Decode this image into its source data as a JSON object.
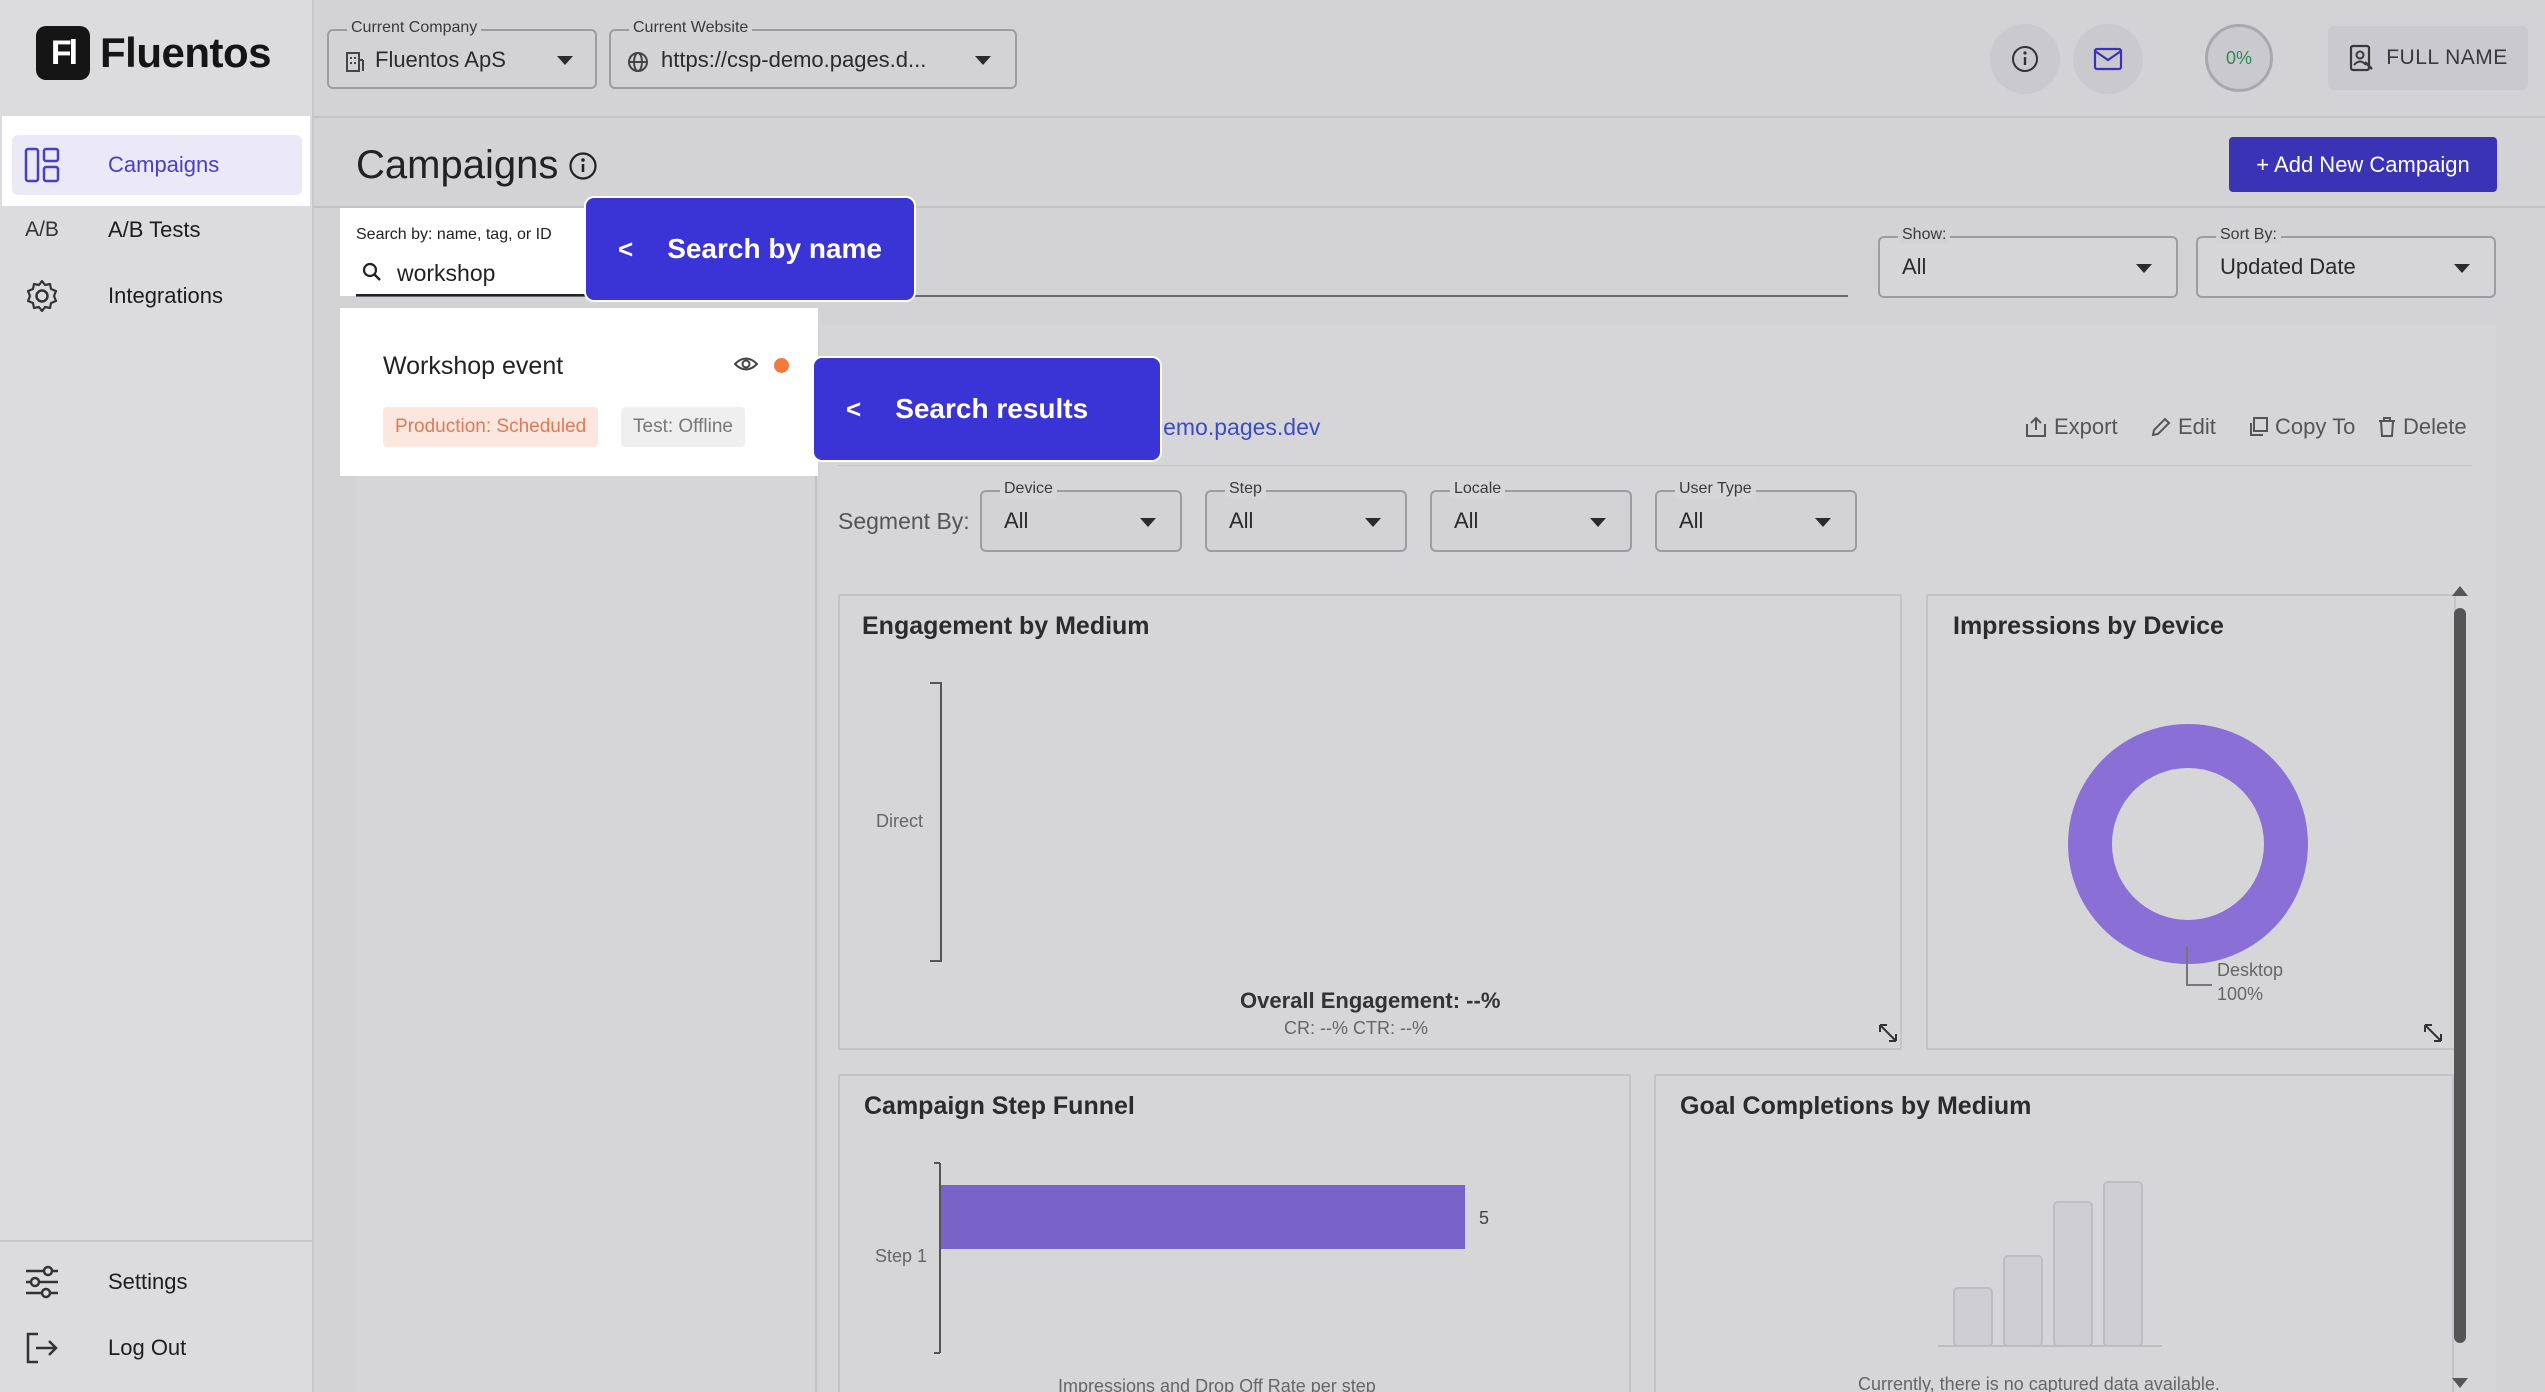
{
  "brand": {
    "logo_mark": "Fl",
    "name": "Fluentos"
  },
  "sidebar": {
    "items": [
      {
        "label": "Campaigns",
        "icon": "layout-icon",
        "active": true
      },
      {
        "label": "A/B Tests",
        "icon_text": "A/B"
      },
      {
        "label": "Integrations",
        "icon": "gear-icon"
      }
    ],
    "bottom": [
      {
        "label": "Settings",
        "icon": "sliders-icon"
      },
      {
        "label": "Log Out",
        "icon": "logout-icon"
      }
    ]
  },
  "topbar": {
    "company": {
      "caption": "Current Company",
      "value": "Fluentos ApS"
    },
    "website": {
      "caption": "Current Website",
      "value": "https://csp-demo.pages.d..."
    },
    "progress": "0%",
    "user": "FULL NAME"
  },
  "header": {
    "title": "Campaigns",
    "add_button": "+ Add New Campaign"
  },
  "search": {
    "caption": "Search by: name, tag, or ID",
    "value": "workshop"
  },
  "popovers": {
    "search": "Search by name",
    "results": "Search results",
    "arrow": "<"
  },
  "filters": {
    "show": {
      "caption": "Show:",
      "value": "All"
    },
    "sort": {
      "caption": "Sort By:",
      "value": "Updated Date"
    }
  },
  "results": [
    {
      "name": "Workshop event",
      "production": "Production: Scheduled",
      "test": "Test: Offline"
    }
  ],
  "detail": {
    "url_fragment": "lemo.pages.dev",
    "actions": {
      "export": "Export",
      "edit": "Edit",
      "copy": "Copy To",
      "delete": "Delete"
    },
    "segment_label": "Segment By:",
    "segments": [
      {
        "caption": "Device",
        "value": "All"
      },
      {
        "caption": "Step",
        "value": "All"
      },
      {
        "caption": "Locale",
        "value": "All"
      },
      {
        "caption": "User Type",
        "value": "All"
      }
    ]
  },
  "charts": {
    "engagement": {
      "title": "Engagement by Medium",
      "category": "Direct",
      "overall": "Overall Engagement: --%",
      "sub": "CR: --%   CTR: --%"
    },
    "impressions": {
      "title": "Impressions by Device",
      "legend_name": "Desktop",
      "legend_value": "100%",
      "color": "#8a70d6"
    },
    "funnel": {
      "title": "Campaign Step Funnel",
      "step": "Step 1",
      "value_label": "5",
      "footer": "Impressions and Drop Off Rate per step",
      "color": "#7a63c8"
    },
    "goals": {
      "title": "Goal Completions by Medium",
      "empty": "Currently, there is no captured data available."
    }
  },
  "chart_data": [
    {
      "type": "bar",
      "title": "Campaign Step Funnel",
      "categories": [
        "Step 1"
      ],
      "values": [
        5
      ]
    },
    {
      "type": "pie",
      "title": "Impressions by Device",
      "categories": [
        "Desktop"
      ],
      "values": [
        100
      ]
    }
  ]
}
